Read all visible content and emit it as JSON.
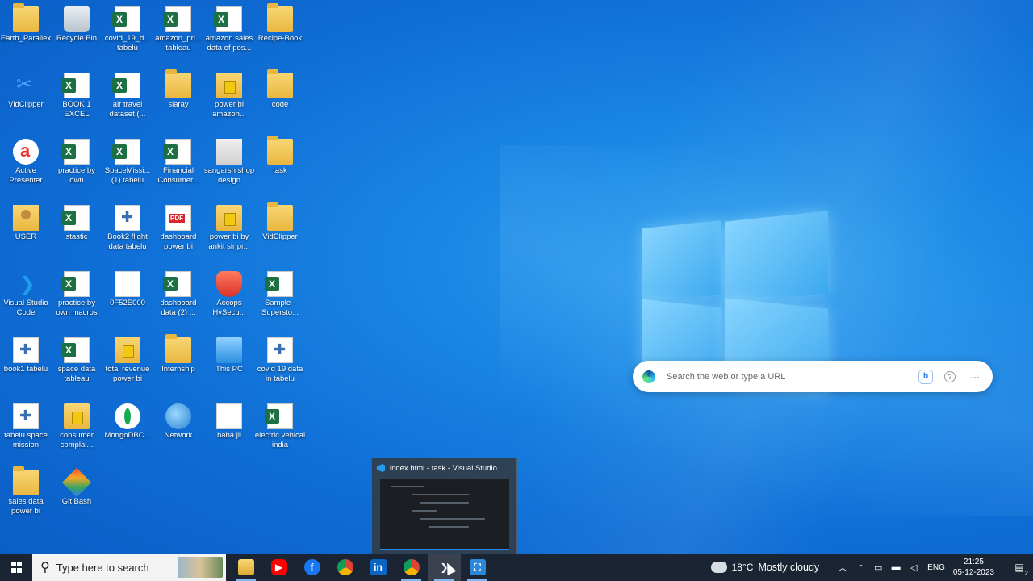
{
  "desktop": {
    "icons": [
      {
        "label": "Earth_Parallex",
        "type": "folder"
      },
      {
        "label": "Recycle Bin",
        "type": "recycle"
      },
      {
        "label": "covid_19_d... tabelu",
        "type": "excel"
      },
      {
        "label": "amazon_pri... tableau",
        "type": "excel"
      },
      {
        "label": "amazon sales data of pos...",
        "type": "excel"
      },
      {
        "label": "Recipe-Book",
        "type": "folder"
      },
      {
        "label": "VidClipper",
        "type": "vidclip"
      },
      {
        "label": "BOOK 1 EXCEL",
        "type": "excel"
      },
      {
        "label": "air travel dataset (...",
        "type": "excel"
      },
      {
        "label": "slaray",
        "type": "folder"
      },
      {
        "label": "power bi amazon...",
        "type": "pbi"
      },
      {
        "label": "code",
        "type": "folder"
      },
      {
        "label": "Active Presenter",
        "type": "active"
      },
      {
        "label": "practice by own",
        "type": "excel"
      },
      {
        "label": "SpaceMissi... (1) tabelu",
        "type": "excel"
      },
      {
        "label": "Financial Consumer...",
        "type": "excel"
      },
      {
        "label": "sangarsh shop design",
        "type": "design"
      },
      {
        "label": "task",
        "type": "folder"
      },
      {
        "label": "USER",
        "type": "user"
      },
      {
        "label": "stastic",
        "type": "excel"
      },
      {
        "label": "Book2 flight data tabelu",
        "type": "tableau"
      },
      {
        "label": "dashboard power bi",
        "type": "pdf"
      },
      {
        "label": "power bi by ankit sir pr...",
        "type": "pbi"
      },
      {
        "label": "VidClipper",
        "type": "folder"
      },
      {
        "label": "Visual Studio Code",
        "type": "vscode"
      },
      {
        "label": "practice by own macros",
        "type": "excel"
      },
      {
        "label": "0F52E000",
        "type": "file"
      },
      {
        "label": "dashboard data (2) ...",
        "type": "excel"
      },
      {
        "label": "Accops HySecu...",
        "type": "shield"
      },
      {
        "label": "Sample - Supersto...",
        "type": "excel"
      },
      {
        "label": "book1 tabelu",
        "type": "tableau"
      },
      {
        "label": "space data tableau",
        "type": "excel"
      },
      {
        "label": "total revenue power bi",
        "type": "pbi"
      },
      {
        "label": "Internship",
        "type": "folder"
      },
      {
        "label": "This PC",
        "type": "pc"
      },
      {
        "label": "covid 19 data in tabelu",
        "type": "tableau"
      },
      {
        "label": "tabelu space mission",
        "type": "tableau"
      },
      {
        "label": "consumer complai...",
        "type": "pbi"
      },
      {
        "label": "MongoDBC...",
        "type": "mongo"
      },
      {
        "label": "Network",
        "type": "net"
      },
      {
        "label": "baba jii",
        "type": "file"
      },
      {
        "label": "electric vehical india",
        "type": "excel"
      },
      {
        "label": "sales data power bi",
        "type": "folder"
      },
      {
        "label": "Git Bash",
        "type": "git"
      }
    ]
  },
  "search_bar": {
    "placeholder": "Search the web or type a URL",
    "bing_label": "b",
    "help_label": "?",
    "more_label": "···"
  },
  "vscode_preview": {
    "title": "index.html - task - Visual Studio..."
  },
  "taskbar": {
    "search_placeholder": "Type here to search",
    "apps": [
      {
        "name": "File Explorer",
        "icon": "folder-icon",
        "active": false
      },
      {
        "name": "YouTube",
        "icon": "youtube-icon",
        "active": false
      },
      {
        "name": "Facebook",
        "icon": "facebook-icon",
        "active": false
      },
      {
        "name": "Google Chrome",
        "icon": "chrome-icon",
        "active": false
      },
      {
        "name": "LinkedIn",
        "icon": "linkedin-icon",
        "active": false
      },
      {
        "name": "Chrome",
        "icon": "chrome-icon",
        "active": false
      },
      {
        "name": "Visual Studio Code",
        "icon": "vscode-icon",
        "active": true
      },
      {
        "name": "Azure Data Studio",
        "icon": "azure-icon",
        "active": false
      }
    ],
    "weather": {
      "temp": "18°C",
      "condition": "Mostly cloudy"
    },
    "language": "ENG",
    "time": "21:25",
    "date": "05-12-2023",
    "notification_count": "12"
  }
}
